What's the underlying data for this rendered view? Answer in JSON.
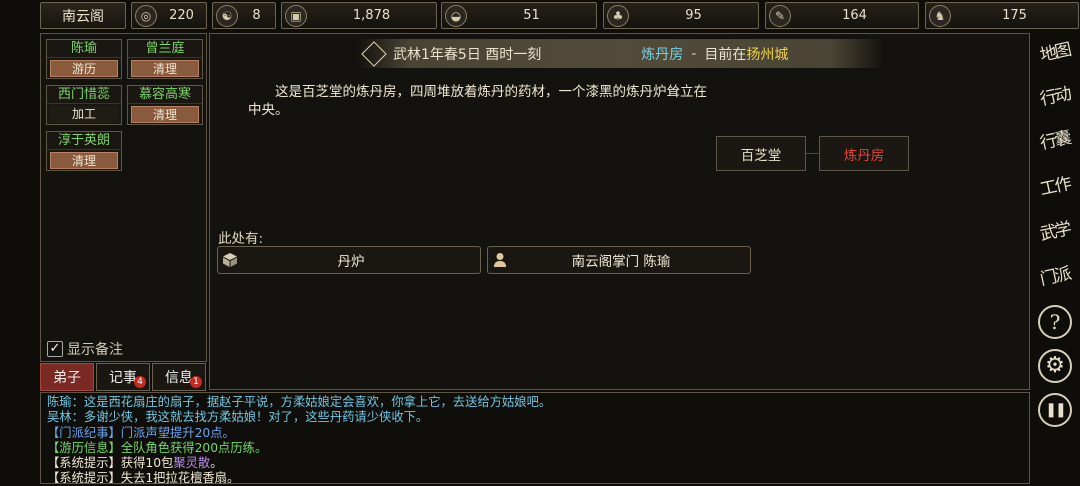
{
  "topbar": {
    "sect_name": "南云阁",
    "resources": [
      {
        "icon": "swirl-icon",
        "glyph": "◎",
        "value": "220"
      },
      {
        "icon": "yin-yang-icon",
        "glyph": "☯",
        "value": "8"
      },
      {
        "icon": "coin-icon",
        "glyph": "▣",
        "value": "1,878"
      },
      {
        "icon": "rice-bowl-icon",
        "glyph": "◒",
        "value": "51"
      },
      {
        "icon": "herb-icon",
        "glyph": "♣",
        "value": "95"
      },
      {
        "icon": "scroll-icon",
        "glyph": "✎",
        "value": "164"
      },
      {
        "icon": "beast-icon",
        "glyph": "♞",
        "value": "175"
      }
    ]
  },
  "disciples": [
    {
      "name": "陈瑜",
      "status": "游历"
    },
    {
      "name": "曾兰庭",
      "status": "清理"
    },
    {
      "name": "西门惜蕊",
      "status": "加工"
    },
    {
      "name": "慕容高寒",
      "status": "清理"
    },
    {
      "name": "淳于英朗",
      "status": "清理"
    }
  ],
  "show_note_label": "显示备注",
  "tabs": [
    {
      "label": "弟子",
      "badge": ""
    },
    {
      "label": "记事",
      "badge": "4"
    },
    {
      "label": "信息",
      "badge": "1"
    }
  ],
  "header": {
    "time": "武林1年春5日 酉时一刻",
    "room": "炼丹房",
    "sep": "-",
    "location_prefix": "目前在",
    "city": "扬州城"
  },
  "description": "这是百芝堂的炼丹房，四周堆放着炼丹的药材，一个漆黑的炼丹炉耸立在中央。",
  "rooms": [
    {
      "label": "百芝堂",
      "current": false
    },
    {
      "label": "炼丹房",
      "current": true
    }
  ],
  "here_label": "此处有:",
  "objects": [
    {
      "icon": "box-icon",
      "label": "丹炉"
    },
    {
      "icon": "person-icon",
      "label": "南云阁掌门 陈瑜"
    }
  ],
  "log": [
    [
      {
        "t": "陈瑜：这是西花扇庄的扇子，据赵子平说，方柔姑娘定会喜欢，你拿上它，去送给方姑娘吧。",
        "c": "cyan"
      }
    ],
    [
      {
        "t": "吴林：多谢少侠，我这就去找方柔姑娘！对了，这些丹药请少侠收下。",
        "c": "cyan"
      }
    ],
    [
      {
        "t": "【门派纪事】",
        "c": "blue"
      },
      {
        "t": "门派声望提升20点。",
        "c": "blue"
      }
    ],
    [
      {
        "t": "【游历信息】",
        "c": "green"
      },
      {
        "t": "全队角色获得200点历练。",
        "c": "green"
      }
    ],
    [
      {
        "t": "【系统提示】获得10包",
        "c": "white"
      },
      {
        "t": "聚灵散",
        "c": "purple"
      },
      {
        "t": "。",
        "c": "white"
      }
    ],
    [
      {
        "t": "【系统提示】失去1把拉花檀香扇。",
        "c": "white"
      }
    ]
  ],
  "side_menu": [
    {
      "label": "地图",
      "icon": "map-icon"
    },
    {
      "label": "行动",
      "icon": "action-icon"
    },
    {
      "label": "行囊",
      "icon": "bag-icon"
    },
    {
      "label": "工作",
      "icon": "work-icon"
    },
    {
      "label": "武学",
      "icon": "martial-icon"
    },
    {
      "label": "门派",
      "icon": "sect-icon"
    }
  ],
  "side_buttons": [
    {
      "glyph": "?",
      "icon": "help-icon"
    },
    {
      "glyph": "⚙",
      "icon": "settings-icon"
    },
    {
      "glyph": "❚❚",
      "icon": "pause-icon"
    }
  ]
}
